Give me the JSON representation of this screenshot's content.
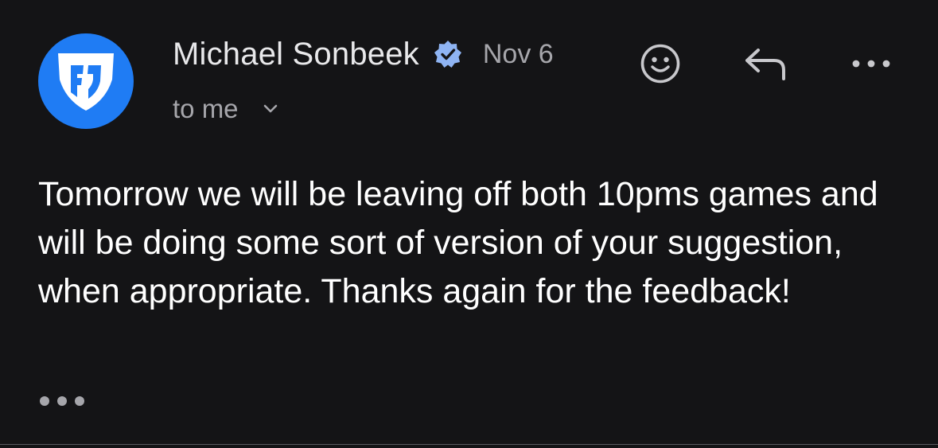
{
  "message": {
    "sender": {
      "avatar_icon": "fanduel-logo-icon",
      "name": "Michael Sonbeek",
      "verified_icon": "verified-badge-icon"
    },
    "date": "Nov 6",
    "recipient": "to me",
    "body": "Tomorrow we will be leaving off both 10pms games and will be doing some sort of version of your suggestion, when appropriate. Thanks again for the feedback!"
  },
  "actions": [
    {
      "icon": "emoji-react-icon"
    },
    {
      "icon": "reply-icon"
    },
    {
      "icon": "more-horizontal-icon"
    }
  ],
  "colors": {
    "background": "#141416",
    "avatar_bg": "#1f7cf4",
    "verified_badge": "#8fb4f3",
    "primary_text": "#ffffff",
    "secondary_text": "#a6a6ab"
  }
}
